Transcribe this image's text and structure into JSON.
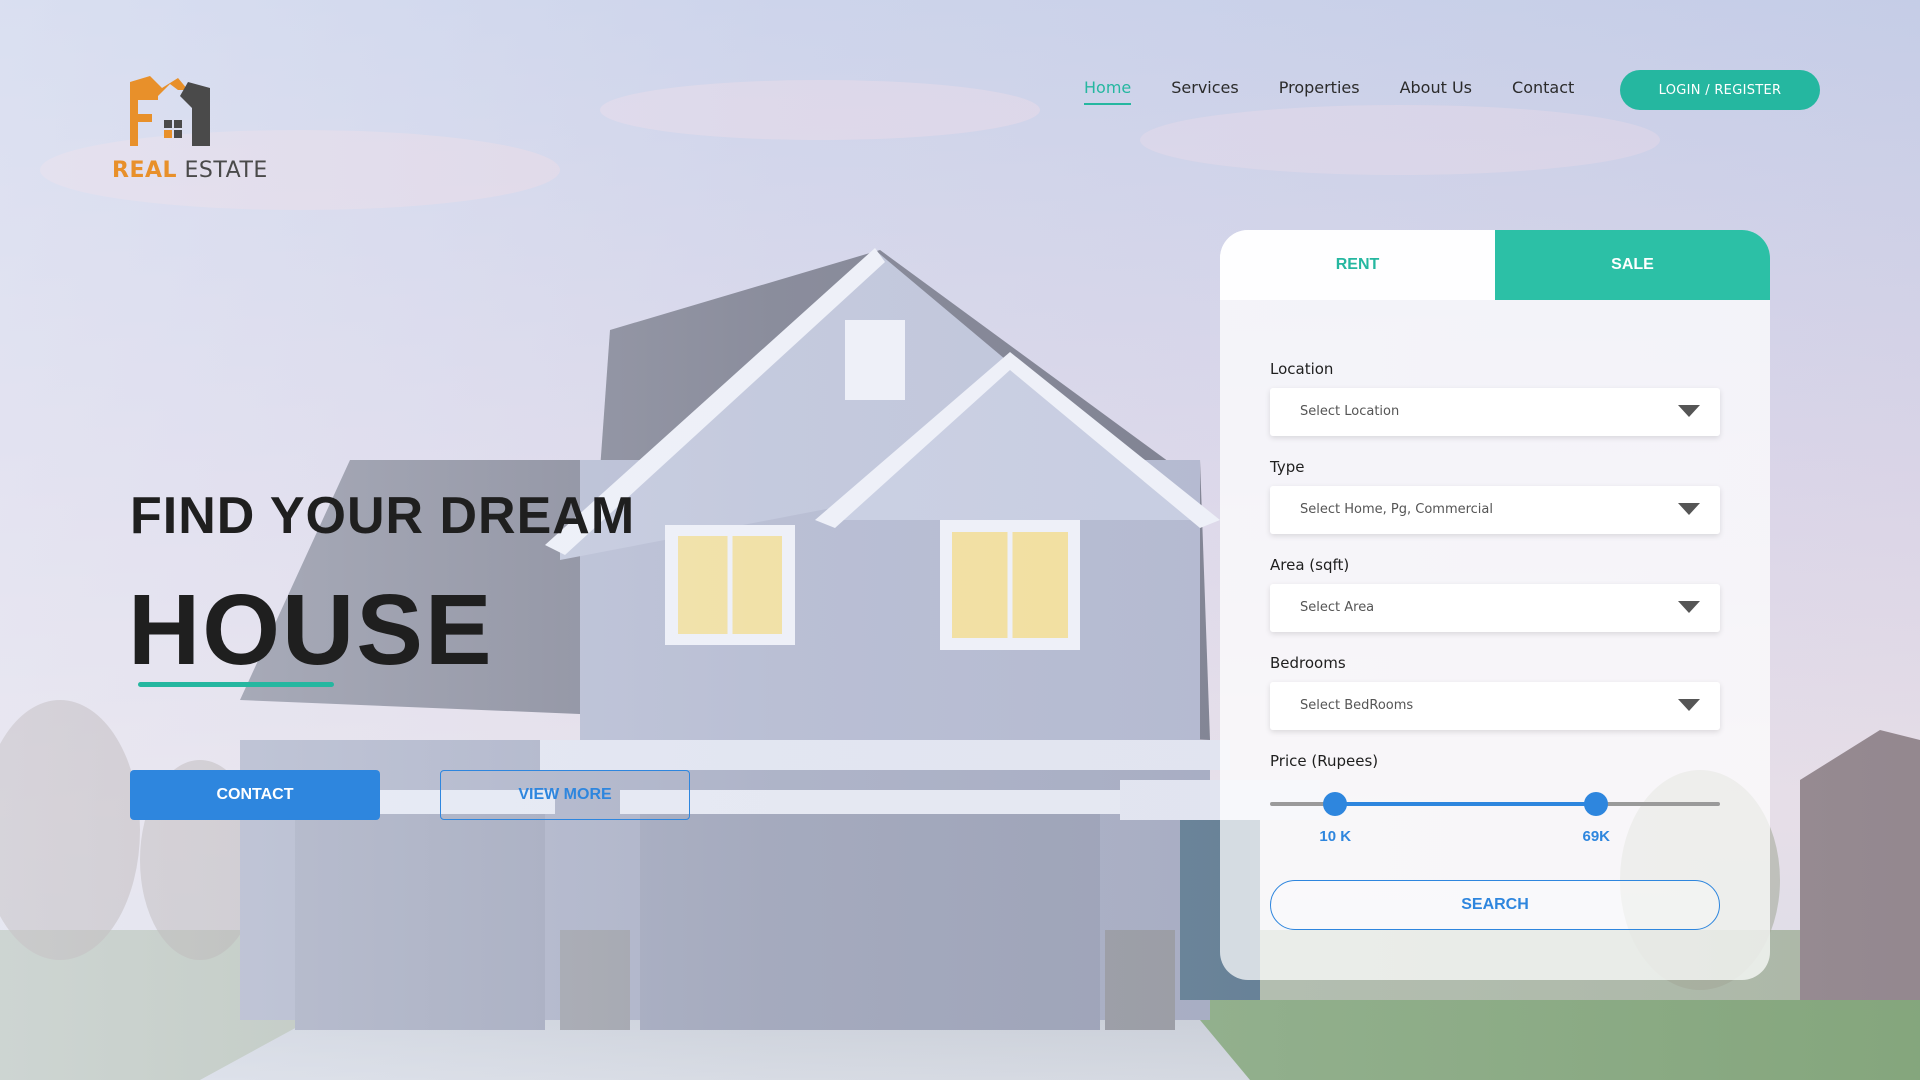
{
  "logo": {
    "word1": "REAL",
    "word2": "ESTATE"
  },
  "nav": {
    "items": [
      "Home",
      "Services",
      "Properties",
      "About Us",
      "Contact"
    ],
    "active": "Home",
    "login_label": "LOGIN / REGISTER"
  },
  "hero": {
    "line1": "FIND YOUR DREAM",
    "line2": "HOUSE",
    "contact_label": "CONTACT",
    "viewmore_label": "VIEW MORE"
  },
  "search": {
    "tabs": {
      "rent": "RENT",
      "sale": "SALE"
    },
    "location": {
      "label": "Location",
      "placeholder": "Select Location"
    },
    "type": {
      "label": "Type",
      "placeholder": "Select Home, Pg, Commercial"
    },
    "area": {
      "label": "Area (sqft)",
      "placeholder": "Select Area"
    },
    "bedrooms": {
      "label": "Bedrooms",
      "placeholder": "Select  BedRooms"
    },
    "price": {
      "label": "Price (Rupees)",
      "min_label": "10 K",
      "max_label": "69K",
      "min_fraction": 0.145,
      "max_fraction": 0.725
    },
    "search_label": "SEARCH"
  },
  "colors": {
    "accent_teal": "#25b7a0",
    "accent_blue": "#2e86de",
    "logo_orange": "#e8902a",
    "logo_gray": "#4a4a4a"
  },
  "icons": {
    "logo": "house-logo-icon",
    "caret": "chevron-down-icon"
  }
}
